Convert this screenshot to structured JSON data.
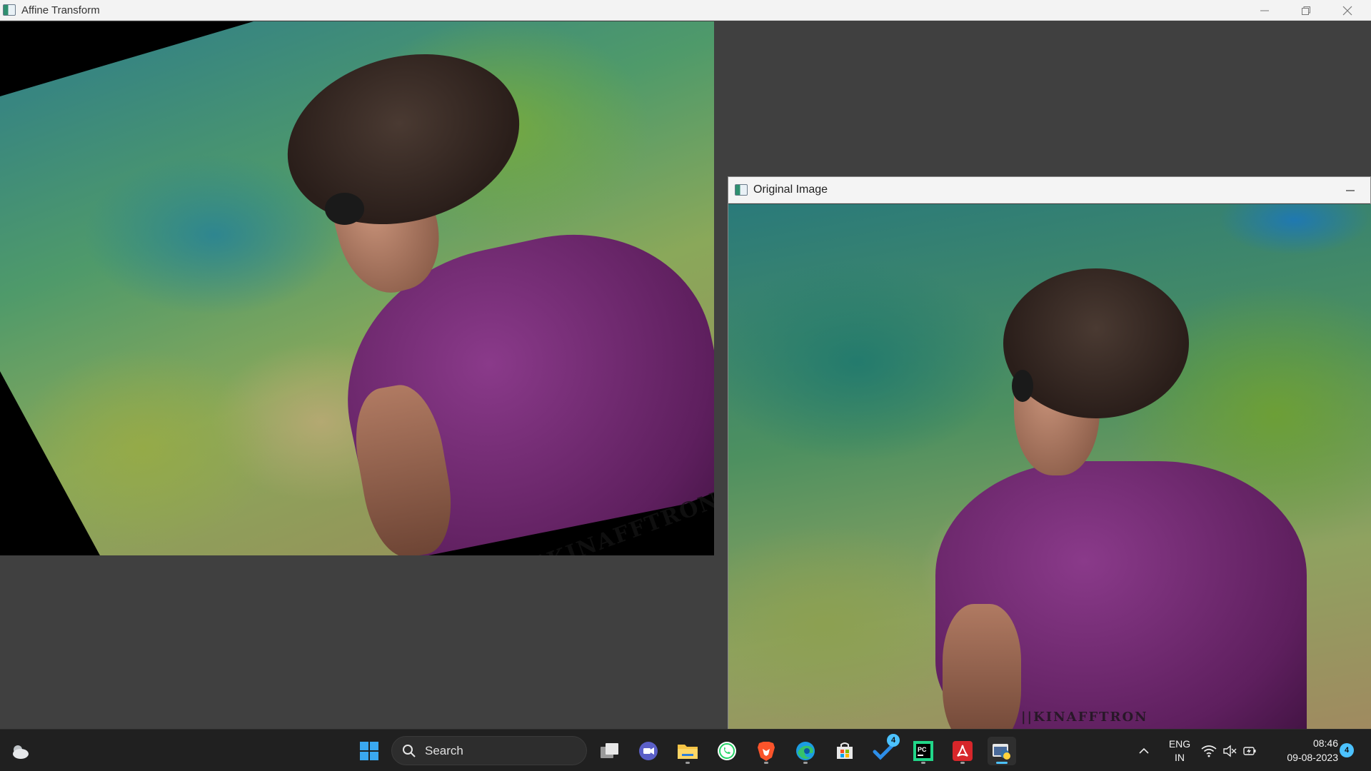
{
  "main_window": {
    "title": "Affine Transform",
    "title_icon": "opencv-window-icon",
    "controls": [
      "minimize-icon",
      "restore-icon",
      "close-icon"
    ]
  },
  "transformed_image": {
    "watermark": "||KINAFFTRON"
  },
  "original_window": {
    "title": "Original Image",
    "title_icon": "opencv-window-icon",
    "controls": [
      "minimize-icon"
    ],
    "watermark": "||KINAFFTRON"
  },
  "taskbar": {
    "weather_icon": "weather-cloud-icon",
    "search_placeholder": "Search",
    "apps": [
      {
        "name": "start",
        "icon": "windows-logo-icon"
      },
      {
        "name": "task-view",
        "icon": "task-view-icon"
      },
      {
        "name": "teams-meet",
        "icon": "video-meet-icon"
      },
      {
        "name": "file-explorer",
        "icon": "folder-icon"
      },
      {
        "name": "whatsapp",
        "icon": "whatsapp-icon"
      },
      {
        "name": "brave",
        "icon": "brave-lion-icon"
      },
      {
        "name": "edge",
        "icon": "edge-icon"
      },
      {
        "name": "store",
        "icon": "store-icon"
      },
      {
        "name": "todo",
        "icon": "todo-check-icon",
        "badge": "4"
      },
      {
        "name": "pycharm",
        "icon": "pycharm-icon"
      },
      {
        "name": "acrobat",
        "icon": "pdf-icon"
      },
      {
        "name": "python",
        "icon": "python-icon"
      }
    ],
    "tray": {
      "language_top": "ENG",
      "language_bottom": "IN",
      "time": "08:46",
      "date": "09-08-2023",
      "notification_count": "4"
    }
  },
  "colors": {
    "accent": "#4cc2ff",
    "taskbar_bg": "#202020",
    "window_bg": "#404040",
    "shirt": "#6b256b"
  }
}
